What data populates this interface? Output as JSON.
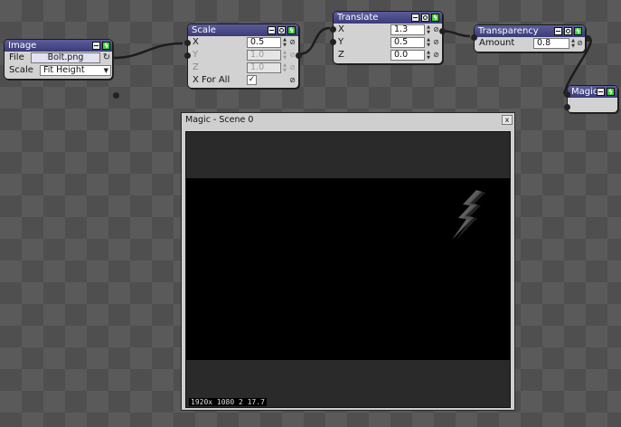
{
  "nodes": {
    "image": {
      "title": "Image",
      "rows": [
        {
          "label": "File",
          "value": "Bolt.png"
        },
        {
          "label": "Scale",
          "value": "Fit Height"
        }
      ]
    },
    "scale": {
      "title": "Scale",
      "rows": [
        {
          "label": "X",
          "value": "0.5"
        },
        {
          "label": "Y",
          "value": "1.0"
        },
        {
          "label": "Z",
          "value": "1.0"
        },
        {
          "label": "X For All",
          "value": "✓"
        }
      ]
    },
    "translate": {
      "title": "Translate",
      "rows": [
        {
          "label": "X",
          "value": "1.3"
        },
        {
          "label": "Y",
          "value": "0.5"
        },
        {
          "label": "Z",
          "value": "0.0"
        }
      ]
    },
    "transparency": {
      "title": "Transparency",
      "rows": [
        {
          "label": "Amount",
          "value": "0.8"
        }
      ]
    },
    "magic": {
      "title": "Magic"
    }
  },
  "preview": {
    "title": "Magic - Scene 0",
    "close": "x",
    "readout": "1920x 1080  2 17.7"
  },
  "colors": {
    "node_header": "#3b3b78",
    "bolt_button": "#3bd03b",
    "canvas_bg": "#5a5a5a"
  },
  "icons": {
    "minimize": "minimize-icon",
    "ring": "ring-icon",
    "execute": "lightning-bolt-icon",
    "reload": "reload-icon",
    "link": "link-icon"
  }
}
